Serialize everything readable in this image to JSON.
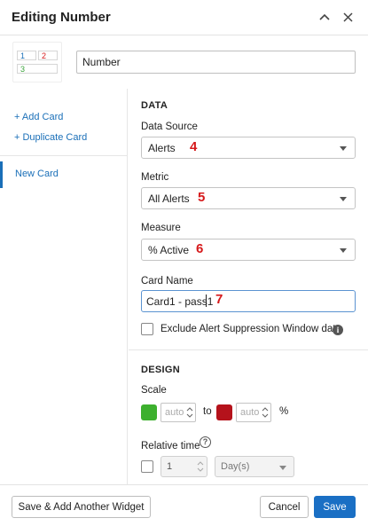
{
  "dialog": {
    "title": "Editing Number"
  },
  "thumbnail": {
    "cells": [
      "1",
      "2",
      "3"
    ],
    "colors": [
      "#1a6fb8",
      "#d6191b",
      "#3aa33a"
    ]
  },
  "widget_name": {
    "value": "Number"
  },
  "sidebar": {
    "add_card": "+ Add Card",
    "duplicate_card": "+ Duplicate Card",
    "cards": [
      "New Card"
    ]
  },
  "data_section": {
    "title": "DATA",
    "data_source": {
      "label": "Data Source",
      "value": "Alerts",
      "marker": "4"
    },
    "metric": {
      "label": "Metric",
      "value": "All Alerts",
      "marker": "5"
    },
    "measure": {
      "label": "Measure",
      "value": "% Active",
      "marker": "6"
    },
    "card_name": {
      "label": "Card Name",
      "value": "Card1 - pass1",
      "marker": "7"
    },
    "exclude_suppression": {
      "label": "Exclude Alert Suppression Window data",
      "checked": false
    }
  },
  "design_section": {
    "title": "DESIGN",
    "scale": {
      "label": "Scale",
      "from_placeholder": "auto",
      "to_text": "to",
      "to_placeholder": "auto",
      "unit": "%",
      "low_color": "#3db02e",
      "high_color": "#b5121b"
    },
    "relative_time": {
      "label": "Relative time",
      "enabled": false,
      "amount": "1",
      "unit": "Day(s)"
    }
  },
  "footer": {
    "save_add_another": "Save & Add Another Widget",
    "cancel": "Cancel",
    "save": "Save"
  },
  "colors": {
    "accent": "#1a6fc4",
    "marker": "#d6191b"
  }
}
